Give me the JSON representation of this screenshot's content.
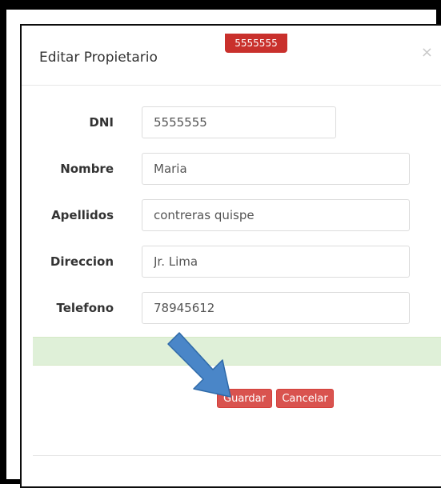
{
  "modal": {
    "title": "Editar Propietario",
    "close_symbol": "×",
    "badge_text": "5555555"
  },
  "form": {
    "fields": [
      {
        "label": "DNI",
        "value": "5555555"
      },
      {
        "label": "Nombre",
        "value": "Maria"
      },
      {
        "label": "Apellidos",
        "value": "contreras quispe"
      },
      {
        "label": "Direccion",
        "value": "Jr. Lima"
      },
      {
        "label": "Telefono",
        "value": "78945612"
      }
    ]
  },
  "actions": {
    "save_label": "Guardar",
    "cancel_label": "Cancelar"
  },
  "colors": {
    "danger": "#d9534f",
    "success_bg": "#dff0d8",
    "annotation_arrow": "#4a86c8"
  },
  "annotation": {
    "icon": "arrow-pointer-icon"
  }
}
